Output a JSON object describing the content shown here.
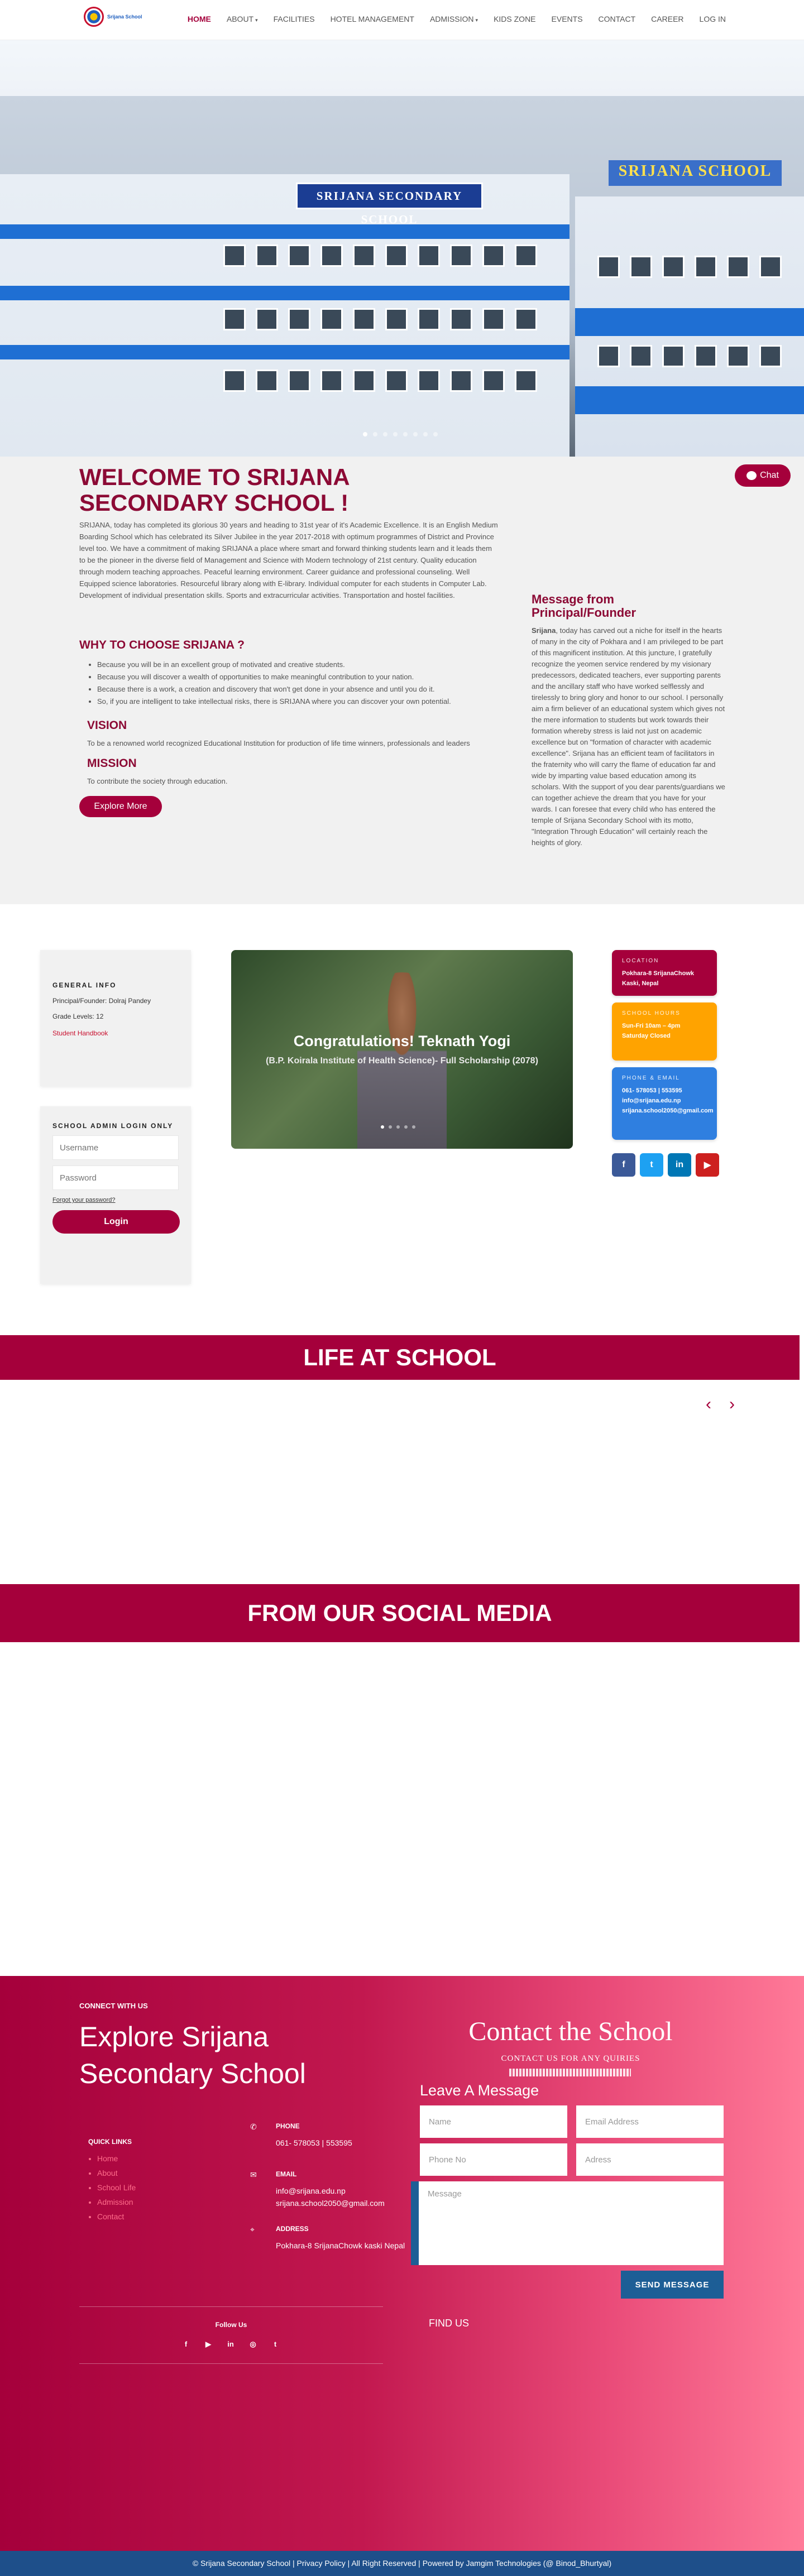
{
  "header": {
    "logo_text": "Srijana School",
    "nav": [
      {
        "label": "HOME",
        "active": true,
        "has_dropdown": false
      },
      {
        "label": "ABOUT",
        "active": false,
        "has_dropdown": true
      },
      {
        "label": "FACILITIES",
        "active": false,
        "has_dropdown": false
      },
      {
        "label": "HOTEL MANAGEMENT",
        "active": false,
        "has_dropdown": false
      },
      {
        "label": "ADMISSION",
        "active": false,
        "has_dropdown": true
      },
      {
        "label": "KIDS ZONE",
        "active": false,
        "has_dropdown": false
      },
      {
        "label": "EVENTS",
        "active": false,
        "has_dropdown": false
      },
      {
        "label": "CONTACT",
        "active": false,
        "has_dropdown": false
      },
      {
        "label": "CAREER",
        "active": false,
        "has_dropdown": false
      },
      {
        "label": "LOG IN",
        "active": false,
        "has_dropdown": false
      }
    ]
  },
  "hero": {
    "sign_main": "SRIJANA SECONDARY SCHOOL",
    "sign_right": "SRIJANA SCHOOL",
    "slide_count": 8,
    "active_slide": 1
  },
  "welcome": {
    "title": "WELCOME TO SRIJANA SECONDARY SCHOOL !",
    "intro": "SRIJANA, today has completed its glorious 30 years and heading to 31st year of it's Academic Excellence. It is an English Medium Boarding School which has celebrated its Silver Jubilee in the year 2017-2018 with optimum programmes of District and Province level too. We have a commitment of making SRIJANA a place where smart and forward thinking students learn and it leads them to be the pioneer in the diverse field of Management and Science with Modern technology of 21st century. Quality education through modern teaching approaches. Peaceful learning environment. Career guidance and professional counseling. Well Equipped science laboratories. Resourceful library along with E-library. Individual computer for each students in Computer Lab. Development of individual presentation skills. Sports and extracurricular activities. Transportation and hostel facilities.",
    "why_title": "WHY TO CHOOSE SRIJANA ?",
    "reasons": [
      "Because you will be in an excellent group of motivated and creative students.",
      "Because you will discover a wealth of opportunities to make meaningful contribution to your nation.",
      "Because there is a work, a creation and discovery that won't get done in your absence and until you do it.",
      "So, if you are intelligent to take intellectual risks, there is SRIJANA where you can discover your own potential."
    ],
    "vision_title": "VISION",
    "vision_text": "To be a renowned world recognized Educational Institution for production of life time winners, professionals and leaders",
    "mission_title": "MISSION",
    "mission_text": "To contribute the society through education.",
    "explore_label": "Explore More",
    "message_title": "Message from Principal/Founder",
    "message_bold": "Srijana",
    "message_text": ", today has carved out a niche for itself in the hearts of many in the city of Pokhara and I am privileged to be part of this magnificent institution. At this juncture, I gratefully recognize the yeomen service rendered by my visionary predecessors, dedicated teachers, ever supporting parents and the ancillary staff who have worked selflessly and tirelessly to bring glory and honor to our school. I personally aim a firm believer of an educational system which gives not the mere information to students but work towards their formation whereby stress is laid not just on academic excellence but on \"formation of character with academic excellence\". Srijana has an efficient team of facilitators in the fraternity who will carry the flame of education far and wide by imparting value based education among its scholars. With the support of you dear parents/guardians we can together achieve the dream that you have for your wards. I can foresee that every child who has entered the temple of Srijana Secondary School with its motto, \"Integration Through Education\" will certainly reach the heights of glory.",
    "chat_label": "Chat"
  },
  "general_info": {
    "title": "GENERAL INFO",
    "principal": "Principal/Founder: Dolraj Pandey",
    "grade": "Grade Levels: 12",
    "handbook": "Student Handbook"
  },
  "login": {
    "title": "SCHOOL ADMIN LOGIN ONLY",
    "username_placeholder": "Username",
    "password_placeholder": "Password",
    "forgot": "Forgot your password?",
    "button": "Login"
  },
  "slider": {
    "caption": "Congratulations! Teknath Yogi",
    "sub": "(B.P. Koirala Institute of Health Science)- Full Scholarship (2078)",
    "slide_count": 5,
    "active_slide": 1
  },
  "info_boxes": {
    "location_label": "LOCATION",
    "location_value": "Pokhara-8 SrijanaChowk Kaski, Nepal",
    "hours_label": "SCHOOL HOURS",
    "hours_value_1": "Sun-Fri 10am – 4pm",
    "hours_value_2": "Saturday Closed",
    "phone_label": "PHONE & EMAIL",
    "phone_value": "061- 578053 | 553595",
    "email_1": "info@srijana.edu.np",
    "email_2": "srijana.school2050@gmail.com",
    "socials": [
      {
        "name": "facebook-icon",
        "glyph": "f",
        "color": "#3b5998"
      },
      {
        "name": "twitter-icon",
        "glyph": "t",
        "color": "#1da1f2"
      },
      {
        "name": "linkedin-icon",
        "glyph": "in",
        "color": "#0077b5"
      },
      {
        "name": "youtube-icon",
        "glyph": "▶",
        "color": "#cd201f"
      }
    ]
  },
  "life": {
    "title": "LIFE AT SCHOOL",
    "prev": "‹",
    "next": "›"
  },
  "social_media": {
    "title": "FROM OUR SOCIAL MEDIA"
  },
  "footer": {
    "connect": "CONNECT WITH US",
    "explore": "Explore Srijana Secondary School",
    "quick_links_title": "QUICK LINKS",
    "quick_links": [
      "Home",
      "About",
      "School Life",
      "Admission",
      "Contact"
    ],
    "phone_label": "PHONE",
    "phone_value": "061- 578053 | 553595",
    "email_label": "EMAIL",
    "email_value_1": "info@srijana.edu.np",
    "email_value_2": "srijana.school2050@gmail.com",
    "address_label": "ADDRESS",
    "address_value": "Pokhara-8 SrijanaChowk kaski Nepal",
    "follow": "Follow Us",
    "contact_title": "Contact the School",
    "contact_sub": "CONTACT US FOR ANY QUIRIES",
    "leave_msg": "Leave A Message",
    "name_placeholder": "Name",
    "email_placeholder": "Email Address",
    "phone_placeholder": "Phone No",
    "address_placeholder": "Adress",
    "message_placeholder": "Message",
    "send": "SEND MESSAGE",
    "find_us": "FIND US"
  },
  "bottom_bar": "© Srijana Secondary School | Privacy Policy | All Right Reserved | Powered by Jamgim Technologies (@ Binod_Bhurtyal)",
  "colors": {
    "brand": "#a5003b",
    "accent_blue": "#2f7fe0",
    "accent_orange": "#ffa300",
    "footer_bar": "#1e4f8a"
  }
}
